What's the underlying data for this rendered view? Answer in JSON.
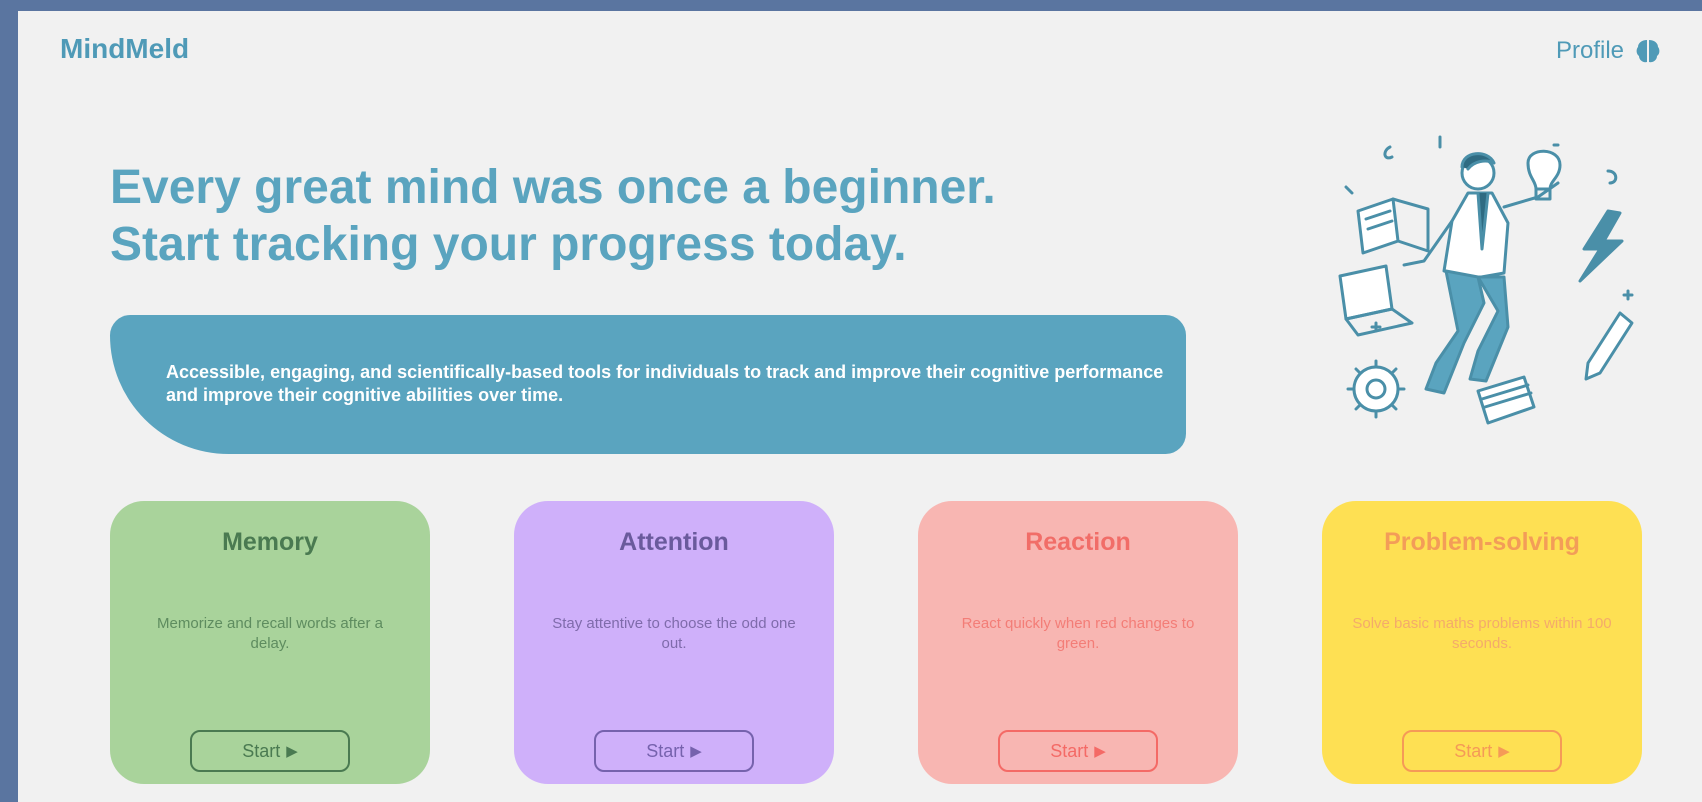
{
  "app": {
    "logo": "MindMeld"
  },
  "header": {
    "profile_label": "Profile",
    "profile_icon": "brain-icon"
  },
  "hero": {
    "headline_line1": "Every great mind was once a beginner.",
    "headline_line2": "Start tracking your progress today.",
    "banner_text": "Accessible, engaging, and scientifically-based tools for individuals to track and improve their cognitive performance and improve their cognitive abilities over time.",
    "illustration": "person-floating-with-study-items-illustration"
  },
  "cards": [
    {
      "title": "Memory",
      "description": "Memorize and recall words after a delay.",
      "button": "Start",
      "button_icon": "▶",
      "color": "#a9d39b"
    },
    {
      "title": "Attention",
      "description": "Stay attentive to choose the odd one out.",
      "button": "Start",
      "button_icon": "▶",
      "color": "#cfb0fa"
    },
    {
      "title": "Reaction",
      "description": "React quickly when red changes to green.",
      "button": "Start",
      "button_icon": "▶",
      "color": "#f8b6b2"
    },
    {
      "title": "Problem-solving",
      "description": "Solve basic maths problems within 100 seconds.",
      "button": "Start",
      "button_icon": "▶",
      "color": "#fee053"
    }
  ],
  "colors": {
    "frame": "#5a75a0",
    "background": "#f1f1f1",
    "accent": "#5aa4bf"
  }
}
